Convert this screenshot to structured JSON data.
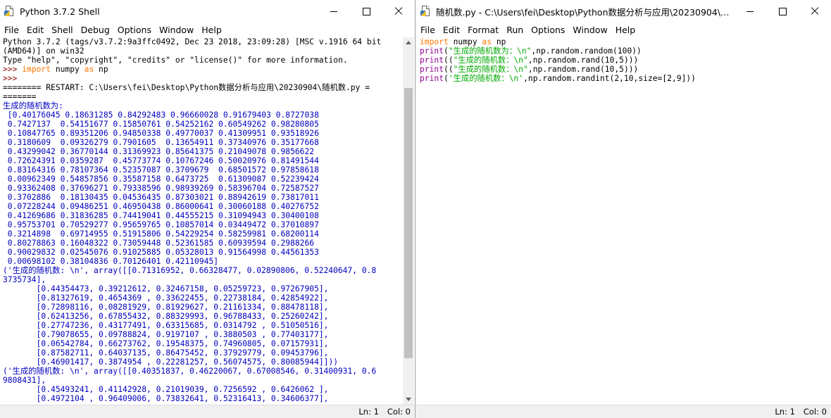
{
  "shell": {
    "title": "Python 3.7.2 Shell",
    "menu": [
      "File",
      "Edit",
      "Shell",
      "Debug",
      "Options",
      "Window",
      "Help"
    ],
    "status_line": "Ln: 1",
    "status_col": "Col: 0",
    "lines": [
      {
        "segs": [
          {
            "t": "Python 3.7.2 (tags/v3.7.2:9a3ffc0492, Dec 23 2018, 23:09:28) [MSC v.1916 64 bit",
            "c": "out"
          }
        ]
      },
      {
        "segs": [
          {
            "t": "(AMD64)] on win32",
            "c": "out"
          }
        ]
      },
      {
        "segs": [
          {
            "t": "Type \"help\", \"copyright\", \"credits\" or \"license()\" for more information.",
            "c": "out"
          }
        ]
      },
      {
        "segs": [
          {
            "t": ">>> ",
            "c": "prompt"
          },
          {
            "t": "import",
            "c": "kw"
          },
          {
            "t": " numpy ",
            "c": "out"
          },
          {
            "t": "as",
            "c": "kw"
          },
          {
            "t": " np",
            "c": "out"
          }
        ]
      },
      {
        "segs": [
          {
            "t": ">>> ",
            "c": "prompt"
          }
        ]
      },
      {
        "segs": [
          {
            "t": "======== RESTART: C:\\Users\\fei\\Desktop\\Python数据分析与应用\\20230904\\随机数.py =",
            "c": "out"
          }
        ]
      },
      {
        "segs": [
          {
            "t": "=======",
            "c": "out"
          }
        ]
      },
      {
        "segs": [
          {
            "t": "生成的随机数为:",
            "c": "blue"
          }
        ]
      },
      {
        "segs": [
          {
            "t": " [0.40176045 0.18631285 0.84292483 0.96660028 0.91679403 0.8727038",
            "c": "blue"
          }
        ]
      },
      {
        "segs": [
          {
            "t": " 0.7427137  0.54151677 0.15850761 0.54252162 0.60549262 0.98280805",
            "c": "blue"
          }
        ]
      },
      {
        "segs": [
          {
            "t": " 0.10847765 0.89351206 0.94850338 0.49770037 0.41309951 0.93518926",
            "c": "blue"
          }
        ]
      },
      {
        "segs": [
          {
            "t": " 0.3180609  0.09326279 0.7901605  0.13654911 0.37340976 0.35177668",
            "c": "blue"
          }
        ]
      },
      {
        "segs": [
          {
            "t": " 0.43299042 0.36770144 0.31369923 0.85641375 0.21049078 0.9856622",
            "c": "blue"
          }
        ]
      },
      {
        "segs": [
          {
            "t": " 0.72624391 0.0359287  0.45773774 0.10767246 0.50020976 0.81491544",
            "c": "blue"
          }
        ]
      },
      {
        "segs": [
          {
            "t": " 0.83164316 0.78107364 0.52357087 0.3709679  0.68501572 0.97858618",
            "c": "blue"
          }
        ]
      },
      {
        "segs": [
          {
            "t": " 0.00962349 0.54857856 0.35587158 0.6473725  0.61309087 0.52239424",
            "c": "blue"
          }
        ]
      },
      {
        "segs": [
          {
            "t": " 0.93362408 0.37696271 0.79338596 0.98939269 0.58396704 0.72587527",
            "c": "blue"
          }
        ]
      },
      {
        "segs": [
          {
            "t": " 0.3702886  0.18130435 0.04536435 0.87303021 0.88942619 0.73817011",
            "c": "blue"
          }
        ]
      },
      {
        "segs": [
          {
            "t": " 0.07228244 0.09486251 0.46950438 0.86000641 0.30060188 0.40276752",
            "c": "blue"
          }
        ]
      },
      {
        "segs": [
          {
            "t": " 0.41269686 0.31836285 0.74419041 0.44555215 0.31094943 0.30400108",
            "c": "blue"
          }
        ]
      },
      {
        "segs": [
          {
            "t": " 0.95753701 0.70529277 0.95659765 0.10857014 0.03449472 0.37010897",
            "c": "blue"
          }
        ]
      },
      {
        "segs": [
          {
            "t": " 0.3214898  0.69714955 0.51915806 0.54229254 0.58259981 0.68200114",
            "c": "blue"
          }
        ]
      },
      {
        "segs": [
          {
            "t": " 0.80278863 0.16048322 0.73059448 0.52361585 0.60939594 0.2988266",
            "c": "blue"
          }
        ]
      },
      {
        "segs": [
          {
            "t": " 0.90029832 0.02545076 0.91025885 0.05328013 0.91564998 0.44561353",
            "c": "blue"
          }
        ]
      },
      {
        "segs": [
          {
            "t": " 0.00698102 0.38104836 0.70126401 0.42110945]",
            "c": "blue"
          }
        ]
      },
      {
        "segs": [
          {
            "t": "('生成的随机数: \\n', array([[0.71316952, 0.66328477, 0.02890806, 0.52240647, 0.8",
            "c": "blue"
          }
        ]
      },
      {
        "segs": [
          {
            "t": "3735734],",
            "c": "blue"
          }
        ]
      },
      {
        "segs": [
          {
            "t": "       [0.44354473, 0.39212612, 0.32467158, 0.05259723, 0.97267905],",
            "c": "blue"
          }
        ]
      },
      {
        "segs": [
          {
            "t": "       [0.81327619, 0.4654369 , 0.33622455, 0.22738184, 0.42854922],",
            "c": "blue"
          }
        ]
      },
      {
        "segs": [
          {
            "t": "       [0.72898116, 0.08281929, 0.81929627, 0.21161334, 0.88478118],",
            "c": "blue"
          }
        ]
      },
      {
        "segs": [
          {
            "t": "       [0.62413256, 0.67855432, 0.88329993, 0.96788433, 0.25260242],",
            "c": "blue"
          }
        ]
      },
      {
        "segs": [
          {
            "t": "       [0.27747236, 0.43177491, 0.63315685, 0.0314792 , 0.51050516],",
            "c": "blue"
          }
        ]
      },
      {
        "segs": [
          {
            "t": "       [0.79078655, 0.09788824, 0.9197107 , 0.3880503 , 0.77403177],",
            "c": "blue"
          }
        ]
      },
      {
        "segs": [
          {
            "t": "       [0.06542784, 0.66273762, 0.19548375, 0.74960805, 0.07157931],",
            "c": "blue"
          }
        ]
      },
      {
        "segs": [
          {
            "t": "       [0.87582711, 0.64037135, 0.86475452, 0.37929779, 0.09453796],",
            "c": "blue"
          }
        ]
      },
      {
        "segs": [
          {
            "t": "       [0.46901417, 0.3874954 , 0.22281257, 0.56074575, 0.80085944]]))",
            "c": "blue"
          }
        ]
      },
      {
        "segs": [
          {
            "t": "('生成的随机数: \\n', array([[0.40351837, 0.46220067, 0.67008546, 0.31400931, 0.6",
            "c": "blue"
          }
        ]
      },
      {
        "segs": [
          {
            "t": "9808431],",
            "c": "blue"
          }
        ]
      },
      {
        "segs": [
          {
            "t": "       [0.45493241, 0.41142928, 0.21019039, 0.7256592 , 0.6426062 ],",
            "c": "blue"
          }
        ]
      },
      {
        "segs": [
          {
            "t": "       [0.4972104 , 0.96409006, 0.73832641, 0.52316413, 0.34606377],",
            "c": "blue"
          }
        ]
      }
    ]
  },
  "editor": {
    "title": "随机数.py - C:\\Users\\fei\\Desktop\\Python数据分析与应用\\20230904\\随机...",
    "menu": [
      "File",
      "Edit",
      "Format",
      "Run",
      "Options",
      "Window",
      "Help"
    ],
    "status_line": "Ln: 1",
    "status_col": "Col: 0",
    "lines": [
      {
        "segs": [
          {
            "t": "import",
            "c": "kw"
          },
          {
            "t": " numpy ",
            "c": "out"
          },
          {
            "t": "as",
            "c": "kw"
          },
          {
            "t": " np",
            "c": "out"
          }
        ]
      },
      {
        "segs": [
          {
            "t": "print",
            "c": "bi"
          },
          {
            "t": "(",
            "c": "out"
          },
          {
            "t": "\"生成的随机数为：\\n\"",
            "c": "str"
          },
          {
            "t": ",np.random.random(100))",
            "c": "out"
          }
        ]
      },
      {
        "segs": [
          {
            "t": "print",
            "c": "bi"
          },
          {
            "t": "((",
            "c": "out"
          },
          {
            "t": "\"生成的随机数：\\n\"",
            "c": "str"
          },
          {
            "t": ",np.random.rand(10,5)))",
            "c": "out"
          }
        ]
      },
      {
        "segs": [
          {
            "t": "print",
            "c": "bi"
          },
          {
            "t": "((",
            "c": "out"
          },
          {
            "t": "\"生成的随机数：\\n\"",
            "c": "str"
          },
          {
            "t": ",np.random.rand(10,5)))",
            "c": "out"
          }
        ]
      },
      {
        "segs": [
          {
            "t": "print",
            "c": "bi"
          },
          {
            "t": "(",
            "c": "out"
          },
          {
            "t": "'生成的随机数：\\n'",
            "c": "str"
          },
          {
            "t": ",np.random.randint(2,10,size=[2,9]))",
            "c": "out"
          }
        ]
      }
    ]
  }
}
